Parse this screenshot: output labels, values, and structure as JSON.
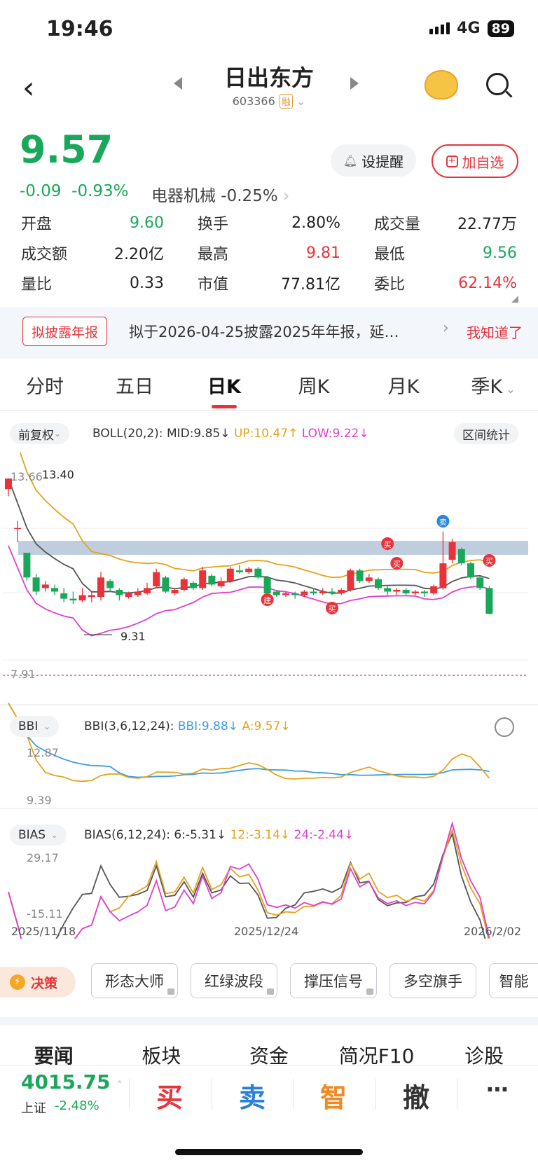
{
  "status": {
    "time": "19:46",
    "network": "4G",
    "battery": "89"
  },
  "header": {
    "name": "日出东方",
    "code": "603366",
    "margin_badge": "融"
  },
  "quote": {
    "price": "9.57",
    "change": "-0.09",
    "change_pct": "-0.93%",
    "sector": "电器机械 -0.25%",
    "alert_label": "设提醒",
    "fav_label": "加自选",
    "stats": [
      {
        "k": "开盘",
        "v": "9.60",
        "color": "#19a85a"
      },
      {
        "k": "换手",
        "v": "2.80%",
        "color": "#222222"
      },
      {
        "k": "成交量",
        "v": "22.77万",
        "color": "#222222"
      },
      {
        "k": "成交额",
        "v": "2.20亿",
        "color": "#222222"
      },
      {
        "k": "最高",
        "v": "9.81",
        "color": "#e8333b"
      },
      {
        "k": "最低",
        "v": "9.56",
        "color": "#19a85a"
      },
      {
        "k": "量比",
        "v": "0.33",
        "color": "#222222"
      },
      {
        "k": "市值",
        "v": "77.81亿",
        "color": "#222222"
      },
      {
        "k": "委比",
        "v": "62.14%",
        "color": "#e8333b"
      }
    ]
  },
  "notice": {
    "tag": "拟披露年报",
    "text": "拟于2026-04-25披露2025年年报，延…",
    "dismiss": "我知道了"
  },
  "period_tabs": [
    "分时",
    "五日",
    "日K",
    "周K",
    "月K",
    "季K"
  ],
  "chart_header": {
    "adjust": "前复权",
    "boll_name": "BOLL(20,2):",
    "boll_mid": "MID:9.85↓",
    "boll_up": "UP:10.47↑",
    "boll_low": "LOW:9.22↓",
    "range_stats": "区间统计"
  },
  "bbi_header": {
    "pill": "BBI",
    "name": "BBI(3,6,12,24):",
    "bbi": "BBI:9.88↓",
    "a": "A:9.57↓"
  },
  "bias_header": {
    "pill": "BIAS",
    "name": "BIAS(6,12,24):",
    "b6": "6:-5.31↓",
    "b12": "12:-3.14↓",
    "b24": "24:-2.44↓"
  },
  "main_axis": {
    "high_mark": "13.66",
    "max_label": "13.40",
    "min_label": "9.31",
    "low_mark": "7.91"
  },
  "bbi_axis": {
    "top": "12.87",
    "bottom": "9.39"
  },
  "bias_axis": {
    "top": "29.17",
    "bottom": "-15.11"
  },
  "dates": [
    "2025/11/18",
    "2025/12/24",
    "2026/2/02"
  ],
  "signals": {
    "buy": "买",
    "sell": "卖",
    "build": "建"
  },
  "colors": {
    "up": "#e8333b",
    "down": "#19a85a",
    "mid": "#555555",
    "upper": "#e6a21c",
    "lower": "#e03fd0",
    "bbi": "#3b9ce0"
  },
  "chart_data": {
    "type": "candlestick",
    "ylim": [
      7.91,
      13.66
    ],
    "candles": [
      [
        13.1,
        13.4,
        13.4,
        12.9
      ],
      [
        12.0,
        12.0,
        12.2,
        11.6
      ],
      [
        11.3,
        10.6,
        11.3,
        10.5
      ],
      [
        10.6,
        10.2,
        10.7,
        10.1
      ],
      [
        10.3,
        10.4,
        10.5,
        10.2
      ],
      [
        10.3,
        10.2,
        10.4,
        10.1
      ],
      [
        10.15,
        10.0,
        10.3,
        9.9
      ],
      [
        10.0,
        9.95,
        10.2,
        9.85
      ],
      [
        9.95,
        10.1,
        10.3,
        9.9
      ],
      [
        10.05,
        10.1,
        10.2,
        9.9
      ],
      [
        10.05,
        10.6,
        10.75,
        9.95
      ],
      [
        10.5,
        10.3,
        10.55,
        10.2
      ],
      [
        10.25,
        10.1,
        10.3,
        9.95
      ],
      [
        10.05,
        10.15,
        10.2,
        10.0
      ],
      [
        10.1,
        10.2,
        10.3,
        10.05
      ],
      [
        10.15,
        10.3,
        10.45,
        10.1
      ],
      [
        10.35,
        10.75,
        10.85,
        10.3
      ],
      [
        10.6,
        10.2,
        10.65,
        10.15
      ],
      [
        10.15,
        10.25,
        10.3,
        10.1
      ],
      [
        10.25,
        10.55,
        10.6,
        10.2
      ],
      [
        10.45,
        10.3,
        10.5,
        10.25
      ],
      [
        10.3,
        10.8,
        10.9,
        10.25
      ],
      [
        10.65,
        10.4,
        10.7,
        10.35
      ],
      [
        10.35,
        10.5,
        10.6,
        10.3
      ],
      [
        10.5,
        10.85,
        10.9,
        10.45
      ],
      [
        10.8,
        10.75,
        10.95,
        10.7
      ],
      [
        10.75,
        10.85,
        10.9,
        10.7
      ],
      [
        10.85,
        10.6,
        10.9,
        10.55
      ],
      [
        10.6,
        10.15,
        10.65,
        10.1
      ],
      [
        10.2,
        10.1,
        10.25,
        10.05
      ],
      [
        10.1,
        10.15,
        10.2,
        10.05
      ],
      [
        10.15,
        10.1,
        10.2,
        10.0
      ],
      [
        10.1,
        10.2,
        10.25,
        10.05
      ],
      [
        10.2,
        10.15,
        10.3,
        10.1
      ],
      [
        10.15,
        10.2,
        10.3,
        10.1
      ],
      [
        10.2,
        10.15,
        10.3,
        10.1
      ],
      [
        10.15,
        10.25,
        10.3,
        10.1
      ],
      [
        10.25,
        10.8,
        10.85,
        10.2
      ],
      [
        10.8,
        10.5,
        10.85,
        10.45
      ],
      [
        10.5,
        10.6,
        10.7,
        10.45
      ],
      [
        10.55,
        10.3,
        10.6,
        10.25
      ],
      [
        10.3,
        10.2,
        10.35,
        10.1
      ],
      [
        10.2,
        10.25,
        10.3,
        10.1
      ],
      [
        10.25,
        10.15,
        10.3,
        10.1
      ],
      [
        10.15,
        10.2,
        10.25,
        10.1
      ],
      [
        10.2,
        10.15,
        10.25,
        10.05
      ],
      [
        10.15,
        10.35,
        10.4,
        10.1
      ],
      [
        10.3,
        11.0,
        11.9,
        10.25
      ],
      [
        11.1,
        11.6,
        11.7,
        11.0
      ],
      [
        11.4,
        11.0,
        11.45,
        10.95
      ],
      [
        11.0,
        10.6,
        11.05,
        10.55
      ],
      [
        10.6,
        10.3,
        10.65,
        10.25
      ],
      [
        10.3,
        9.57,
        10.35,
        9.56
      ]
    ]
  }
}
